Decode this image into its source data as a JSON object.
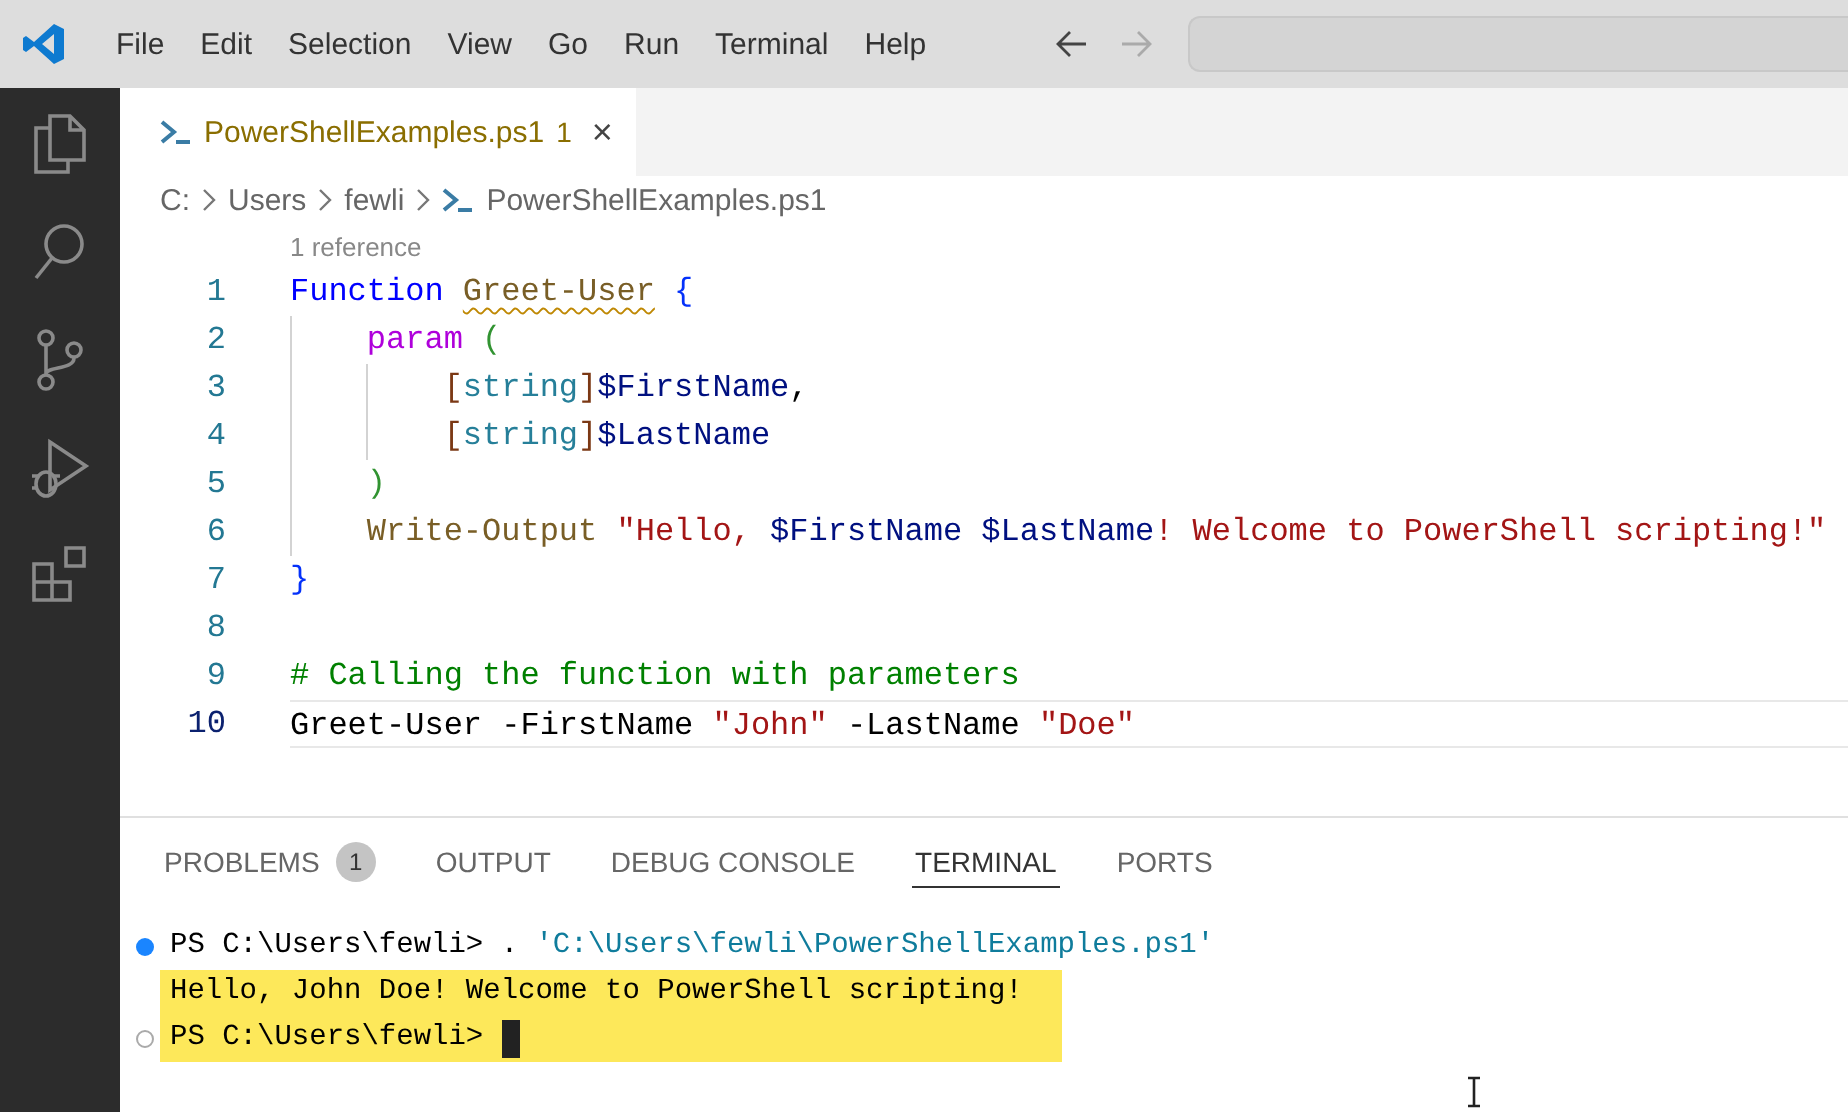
{
  "menu": [
    "File",
    "Edit",
    "Selection",
    "View",
    "Go",
    "Run",
    "Terminal",
    "Help"
  ],
  "tabs": [
    {
      "label": "PowerShellExamples.ps1",
      "problems": "1",
      "close": "×",
      "selected": true
    }
  ],
  "breadcrumb": [
    "C:",
    "Users",
    "fewli",
    "PowerShellExamples.ps1"
  ],
  "codelens": "1 reference",
  "code_lines": [
    {
      "number": "1",
      "current": false,
      "tokens": [
        {
          "text": "Function ",
          "kind": "keyword"
        },
        {
          "text": "Greet-User",
          "kind": "function",
          "warning": true
        },
        {
          "text": " {",
          "kind": "bracket1"
        }
      ]
    },
    {
      "number": "2",
      "current": false,
      "tokens": [
        {
          "text": "    param",
          "kind": "control"
        },
        {
          "text": " (",
          "kind": "bracket2"
        }
      ]
    },
    {
      "number": "3",
      "current": false,
      "tokens": [
        {
          "text": "        [",
          "kind": "bracket3"
        },
        {
          "text": "string",
          "kind": "type"
        },
        {
          "text": "]",
          "kind": "bracket3"
        },
        {
          "text": "$FirstName",
          "kind": "variable"
        },
        {
          "text": ",",
          "kind": "plain"
        }
      ]
    },
    {
      "number": "4",
      "current": false,
      "tokens": [
        {
          "text": "        [",
          "kind": "bracket3"
        },
        {
          "text": "string",
          "kind": "type"
        },
        {
          "text": "]",
          "kind": "bracket3"
        },
        {
          "text": "$LastName",
          "kind": "variable"
        }
      ]
    },
    {
      "number": "5",
      "current": false,
      "tokens": [
        {
          "text": "    )",
          "kind": "bracket2"
        }
      ]
    },
    {
      "number": "6",
      "current": false,
      "tokens": [
        {
          "text": "    Write-Output ",
          "kind": "function"
        },
        {
          "text": "\"Hello, ",
          "kind": "string"
        },
        {
          "text": "$FirstName ",
          "kind": "variable"
        },
        {
          "text": "$LastName",
          "kind": "variable"
        },
        {
          "text": "! Welcome to PowerShell scripting!\"",
          "kind": "string"
        }
      ]
    },
    {
      "number": "7",
      "current": false,
      "tokens": [
        {
          "text": "}",
          "kind": "bracket1"
        }
      ]
    },
    {
      "number": "8",
      "current": false
    },
    {
      "number": "9",
      "current": false,
      "tokens": [
        {
          "text": "# Calling the function with parameters",
          "kind": "comment"
        }
      ]
    },
    {
      "number": "10",
      "current": true,
      "tokens": [
        {
          "text": "Greet-User -FirstName ",
          "kind": "plain"
        },
        {
          "text": "\"John\"",
          "kind": "string"
        },
        {
          "text": " -LastName ",
          "kind": "plain"
        },
        {
          "text": "\"Doe\"",
          "kind": "string"
        }
      ]
    }
  ],
  "panel_tabs": [
    {
      "label": "PROBLEMS",
      "badge": "1",
      "selected": false
    },
    {
      "label": "OUTPUT",
      "selected": false
    },
    {
      "label": "DEBUG CONSOLE",
      "selected": false
    },
    {
      "label": "TERMINAL",
      "selected": true
    },
    {
      "label": "PORTS",
      "selected": false
    }
  ],
  "terminal": [
    {
      "kind": "command",
      "highlighted": false,
      "tokens": [
        {
          "text": "PS C:\\Users\\fewli> . ",
          "kind": "plain"
        },
        {
          "text": "'C:\\Users\\fewli\\PowerShellExamples.ps1'",
          "kind": "path"
        }
      ]
    },
    {
      "kind": "output",
      "highlighted": true,
      "tokens": [
        {
          "text": "Hello, John Doe! Welcome to PowerShell scripting!",
          "kind": "plain"
        }
      ]
    },
    {
      "kind": "prompt",
      "highlighted": true,
      "cursor": true,
      "tokens": [
        {
          "text": "PS C:\\Users\\fewli>",
          "kind": "plain"
        }
      ]
    }
  ]
}
